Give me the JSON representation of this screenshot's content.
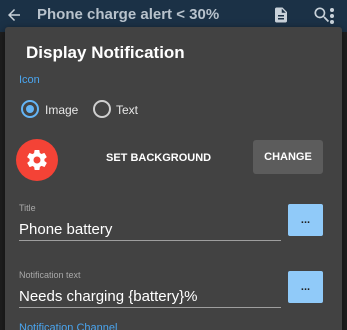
{
  "appbar": {
    "title": "Phone charge alert < 30%",
    "back_icon": "arrow-left-icon",
    "doc_icon": "document-icon",
    "search_icon": "search-icon",
    "more_icon": "more-vert-icon"
  },
  "dialog": {
    "title": "Display Notification",
    "icon_section_label": "Icon",
    "radio_options": [
      {
        "label": "Image",
        "checked": true
      },
      {
        "label": "Text",
        "checked": false
      }
    ],
    "set_background_label": "SET BACKGROUND",
    "change_label": "CHANGE",
    "title_field": {
      "label": "Title",
      "value": "Phone battery",
      "button_label": "..."
    },
    "notification_text_field": {
      "label": "Notification text",
      "value": "Needs charging {battery}%",
      "button_label": "..."
    },
    "channel_label": "Notification Channel"
  },
  "colors": {
    "accent": "#64b5f6",
    "icon_bg": "#f44336",
    "appbar_bg": "#1b3146",
    "dialog_bg": "#424242"
  }
}
